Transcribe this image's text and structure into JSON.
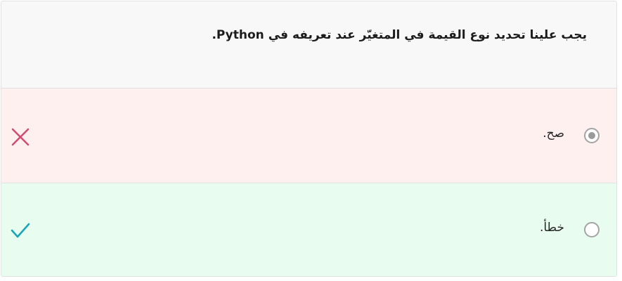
{
  "question": {
    "text": "يجب علينا تحديد نوع القيمة في المتغيّر عند تعريفه في Python."
  },
  "options": [
    {
      "label": "صح.",
      "selected": true,
      "result": "incorrect",
      "icon": "x-icon",
      "background": "#fff0f0",
      "icon_color": "#cf4d74"
    },
    {
      "label": "خطأ.",
      "selected": false,
      "result": "correct",
      "icon": "check-icon",
      "background": "#e8fdef",
      "icon_color": "#1aa6b7"
    }
  ]
}
